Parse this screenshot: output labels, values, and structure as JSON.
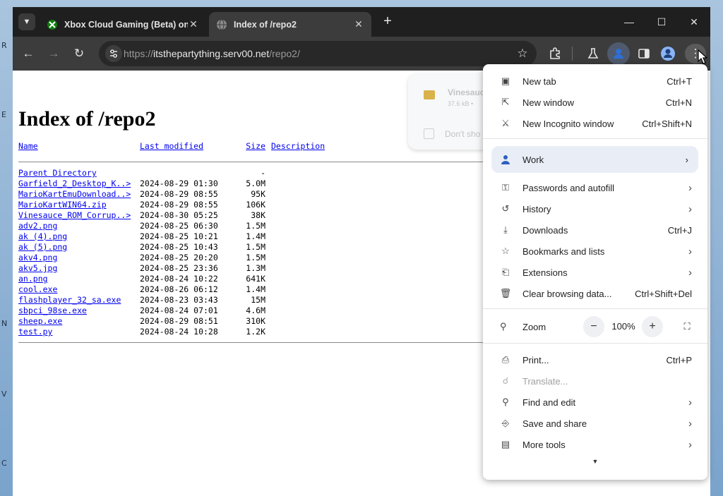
{
  "browser": {
    "tabs": [
      {
        "title": "Xbox Cloud Gaming (Beta) on",
        "active": false
      },
      {
        "title": "Index of /repo2",
        "active": true
      }
    ],
    "url_scheme": "https://",
    "url_host": "itsthepartything.serv00.net",
    "url_path": "/repo2/",
    "icons": {
      "tab_search": "chevron-down-icon",
      "back": "back-arrow-icon",
      "forward": "forward-arrow-icon",
      "reload": "reload-icon",
      "site_info": "tune-icon",
      "bookmark": "star-icon",
      "extensions": "puzzle-icon",
      "labs": "flask-icon",
      "sidepanel": "side-panel-icon",
      "profile": "avatar-icon",
      "menu": "kebab-menu-icon"
    }
  },
  "page": {
    "heading": "Index of /repo2",
    "columns": {
      "name": "Name",
      "modified": "Last modified",
      "size": "Size",
      "description": "Description"
    },
    "parent": {
      "name": "Parent Directory",
      "size": "-"
    },
    "files": [
      {
        "name": "Garfield_2_Desktop_K..>",
        "modified": "2024-08-29 01:30",
        "size": "5.0M"
      },
      {
        "name": "MarioKartEmuDownload..>",
        "modified": "2024-08-29 08:55",
        "size": "95K"
      },
      {
        "name": "MarioKartWIN64.zip",
        "modified": "2024-08-29 08:55",
        "size": "106K"
      },
      {
        "name": "Vinesauce_ROM_Corrup..>",
        "modified": "2024-08-30 05:25",
        "size": "38K"
      },
      {
        "name": "adv2.png",
        "modified": "2024-08-25 06:30",
        "size": "1.5M"
      },
      {
        "name": "ak (4).png",
        "modified": "2024-08-25 10:21",
        "size": "1.4M"
      },
      {
        "name": "ak (5).png",
        "modified": "2024-08-25 10:43",
        "size": "1.5M"
      },
      {
        "name": "akv4.png",
        "modified": "2024-08-25 20:20",
        "size": "1.5M"
      },
      {
        "name": "akv5.jpg",
        "modified": "2024-08-25 23:36",
        "size": "1.3M"
      },
      {
        "name": "an.png",
        "modified": "2024-08-24 10:22",
        "size": "641K"
      },
      {
        "name": "cool.exe",
        "modified": "2024-08-26 06:12",
        "size": "1.4M"
      },
      {
        "name": "flashplayer_32_sa.exe",
        "modified": "2024-08-23 03:43",
        "size": "15M"
      },
      {
        "name": "sbpci_98se.exe",
        "modified": "2024-08-24 07:01",
        "size": "4.6M"
      },
      {
        "name": "sheep.exe",
        "modified": "2024-08-29 08:51",
        "size": "310K"
      },
      {
        "name": "test.py",
        "modified": "2024-08-24 10:28",
        "size": "1.2K"
      }
    ]
  },
  "download_bubble": {
    "filename": "Vinesauce",
    "meta": "37.6 kB •",
    "checkbox_label": "Don't sho"
  },
  "menu": {
    "new_tab": {
      "label": "New tab",
      "shortcut": "Ctrl+T"
    },
    "new_window": {
      "label": "New window",
      "shortcut": "Ctrl+N"
    },
    "incognito": {
      "label": "New Incognito window",
      "shortcut": "Ctrl+Shift+N"
    },
    "profile": {
      "label": "Work"
    },
    "passwords": {
      "label": "Passwords and autofill"
    },
    "history": {
      "label": "History"
    },
    "downloads": {
      "label": "Downloads",
      "shortcut": "Ctrl+J"
    },
    "bookmarks": {
      "label": "Bookmarks and lists"
    },
    "extensions": {
      "label": "Extensions"
    },
    "clear": {
      "label": "Clear browsing data...",
      "shortcut": "Ctrl+Shift+Del"
    },
    "zoom": {
      "label": "Zoom",
      "minus": "−",
      "value": "100%",
      "plus": "+"
    },
    "print": {
      "label": "Print...",
      "shortcut": "Ctrl+P"
    },
    "translate": {
      "label": "Translate..."
    },
    "find": {
      "label": "Find and edit"
    },
    "save": {
      "label": "Save and share"
    },
    "tools": {
      "label": "More tools"
    }
  },
  "colors": {
    "link": "#0000ee",
    "tabstrip": "#1f1f1f",
    "toolbar": "#3c3c3c",
    "profile_highlight": "#e9eef6"
  }
}
